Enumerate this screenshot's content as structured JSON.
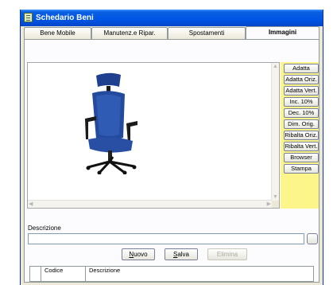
{
  "window": {
    "title": "Schedario Beni",
    "title_bar_color": "#0055e5"
  },
  "tabs": [
    {
      "label": "Bene Mobile",
      "active": false
    },
    {
      "label": "Manutenz.e Ripar.",
      "active": false
    },
    {
      "label": "Spostamenti",
      "active": false
    },
    {
      "label": "Immagini",
      "active": true
    }
  ],
  "image_panel": {
    "image_subject": "blue office chair",
    "accent_color": "#fcf58a"
  },
  "side_buttons": [
    {
      "label": "Adatta"
    },
    {
      "label": "Adatta Oriz."
    },
    {
      "label": "Adatta Vert."
    },
    {
      "label": "Inc. 10%"
    },
    {
      "label": "Dec. 10%"
    },
    {
      "label": "Dim. Orig."
    },
    {
      "label": "Ribalta Oriz."
    },
    {
      "label": "Ribalta Vert."
    },
    {
      "label": "Browser"
    },
    {
      "label": "Stampa"
    }
  ],
  "description": {
    "label": "Descrizione",
    "value": ""
  },
  "actions": {
    "new_label": "Nuovo",
    "save_label": "Salva",
    "delete_label": "Elimina",
    "delete_enabled": false
  },
  "grid": {
    "columns": [
      "Codice",
      "Descrizione"
    ],
    "rows": []
  }
}
